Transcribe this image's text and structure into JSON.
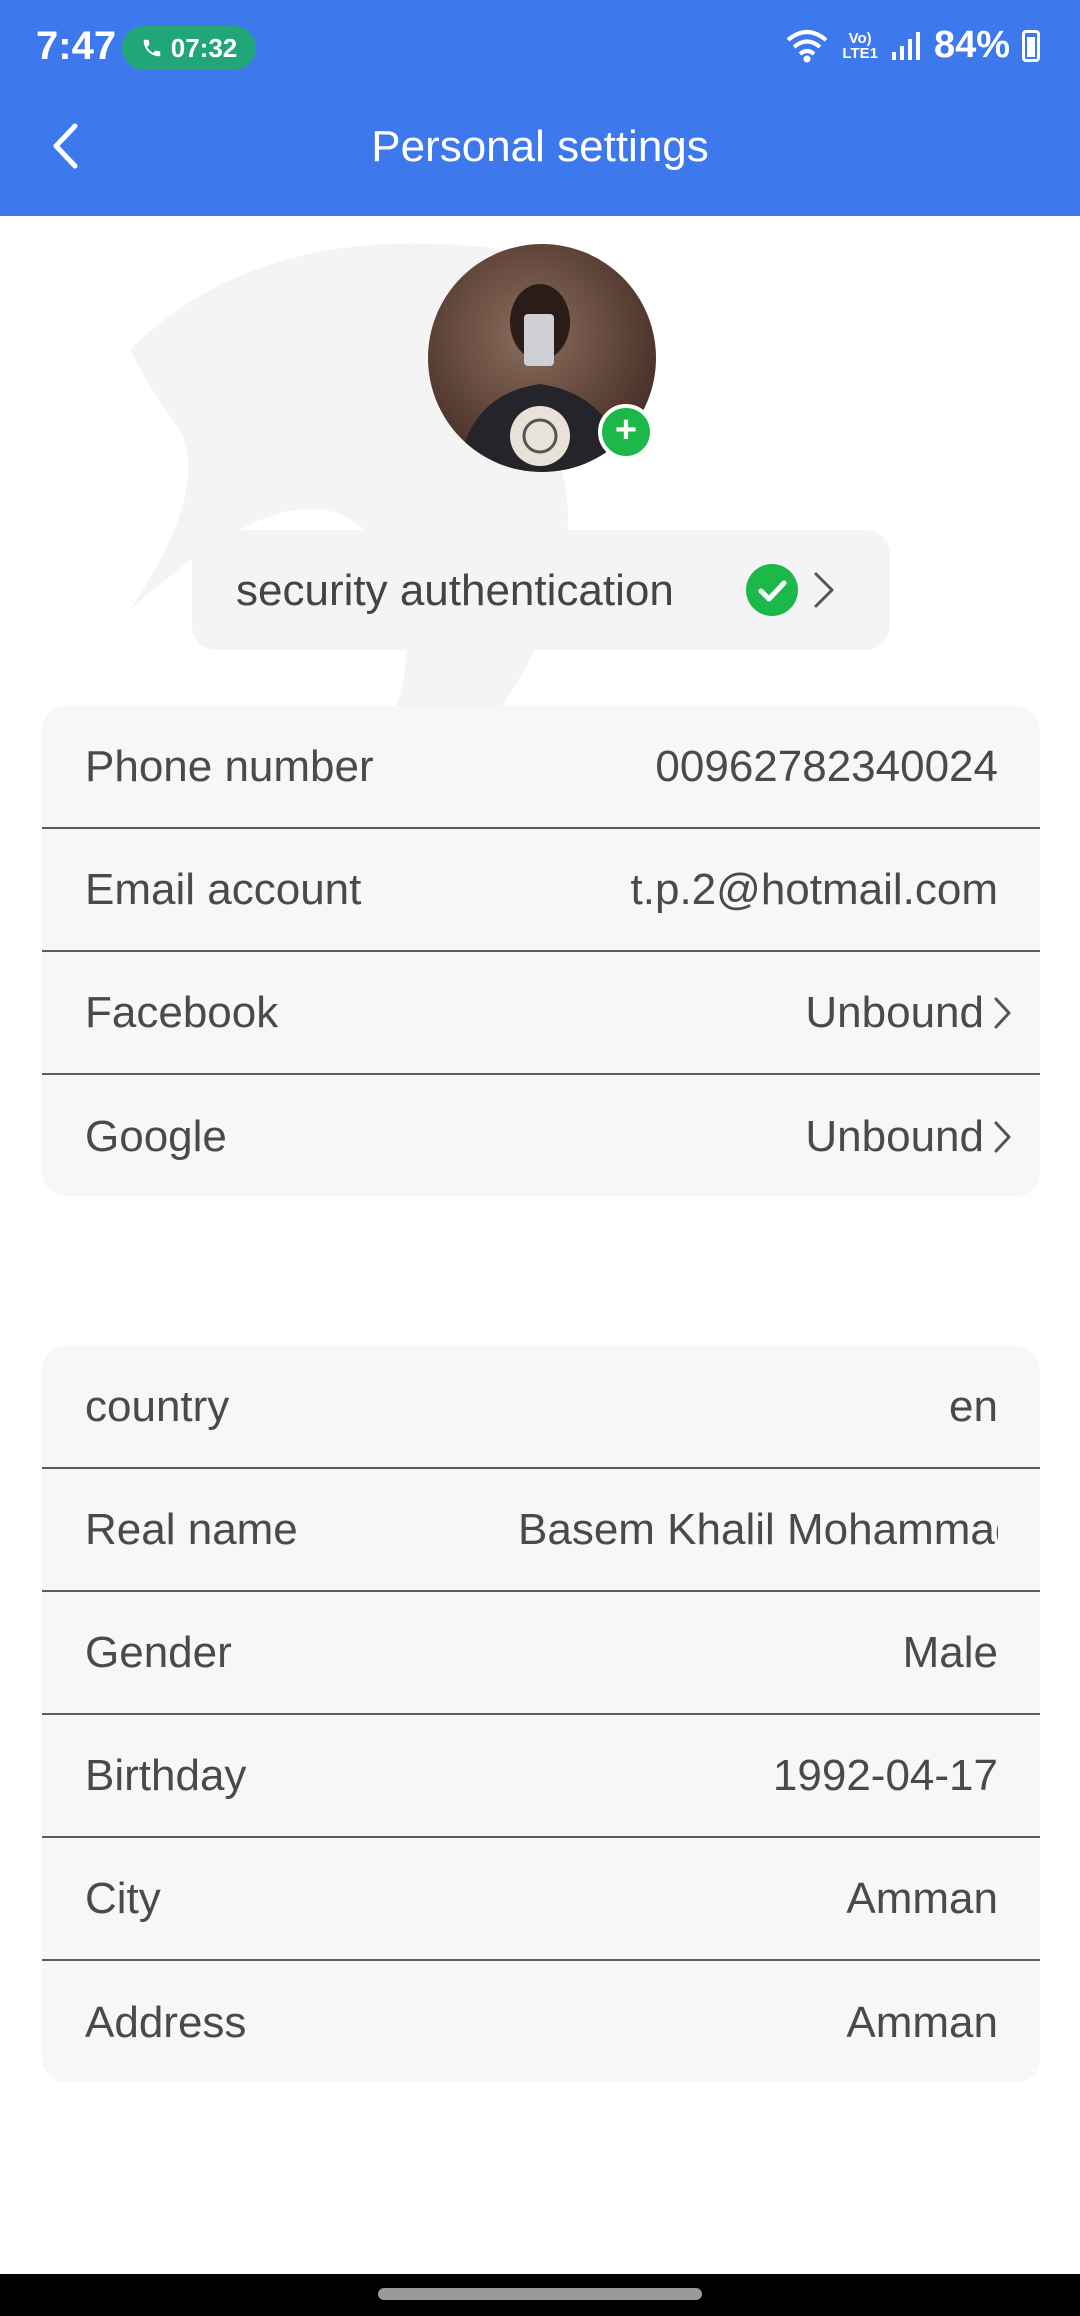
{
  "status_bar": {
    "time": "7:47",
    "call_timer": "07:32",
    "network_type": "Vo)) LTE1",
    "battery": "84%"
  },
  "header": {
    "title": "Personal settings",
    "background_color": "#3d78ec"
  },
  "security": {
    "label": "security authentication",
    "verified": true
  },
  "account_rows": [
    {
      "label": "Phone number",
      "value": "00962782340024",
      "link": false
    },
    {
      "label": "Email account",
      "value": "t.p.2@hotmail.com",
      "link": false
    },
    {
      "label": "Facebook",
      "value": "Unbound",
      "link": true
    },
    {
      "label": "Google",
      "value": "Unbound",
      "link": true
    }
  ],
  "profile_rows": [
    {
      "label": "country",
      "value": "en"
    },
    {
      "label": "Real name",
      "value": "Basem Khalil Mohammad"
    },
    {
      "label": "Gender",
      "value": "Male"
    },
    {
      "label": "Birthday",
      "value": "1992-04-17"
    },
    {
      "label": "City",
      "value": "Amman"
    },
    {
      "label": "Address",
      "value": "Amman"
    }
  ],
  "colors": {
    "accent": "#3d78ec",
    "verified_green": "#1cb84a"
  }
}
